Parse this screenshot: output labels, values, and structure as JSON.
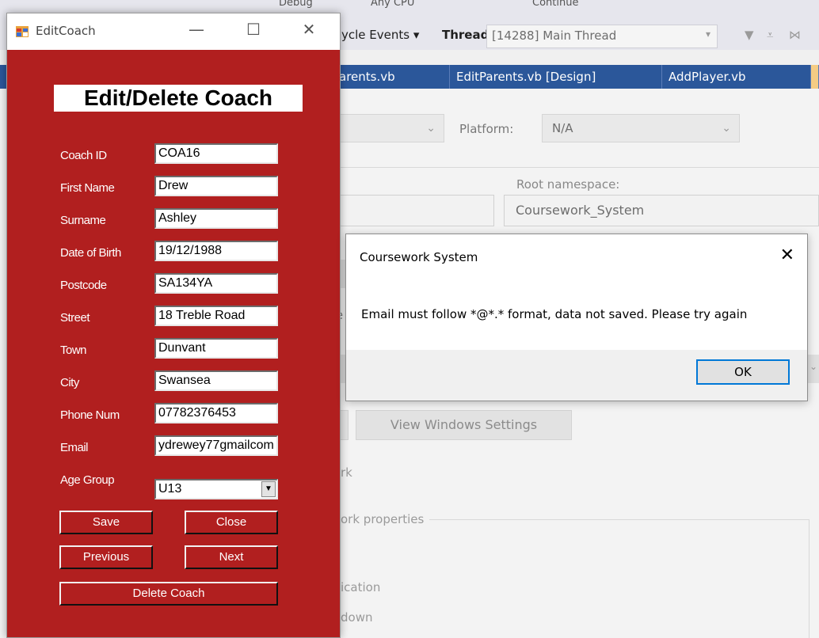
{
  "ide": {
    "toolbar_top": {
      "debug_label": "Debug",
      "cpu_label": "Any CPU",
      "continue_label": "Continue"
    },
    "toolbar": {
      "lifecycle_label": "ycle Events",
      "thread_label": "Thread:",
      "thread_value": "[14288] Main Thread"
    },
    "tabs": [
      {
        "label": "arents.vb"
      },
      {
        "label": "EditParents.vb [Design]"
      },
      {
        "label": "AddPlayer.vb"
      }
    ],
    "platform_label": "Platform:",
    "platform_value": "N/A",
    "root_namespace_label": "Root namespace:",
    "root_namespace_value": "Coursework_System",
    "view_windows_settings": "View Windows Settings",
    "partial_labels": [
      "re",
      "rk",
      "ork properties",
      "ication",
      "down"
    ]
  },
  "editcoach": {
    "window_title": "EditCoach",
    "heading": "Edit/Delete Coach",
    "fields": [
      {
        "label": "Coach ID",
        "value": "COA16"
      },
      {
        "label": "First Name",
        "value": "Drew"
      },
      {
        "label": "Surname",
        "value": "Ashley"
      },
      {
        "label": "Date of Birth",
        "value": "19/12/1988"
      },
      {
        "label": "Postcode",
        "value": "SA134YA"
      },
      {
        "label": "Street",
        "value": "18 Treble Road"
      },
      {
        "label": "Town",
        "value": "Dunvant"
      },
      {
        "label": "City",
        "value": "Swansea"
      },
      {
        "label": "Phone Num",
        "value": "07782376453"
      },
      {
        "label": "Email",
        "value": "ydrewey77gmailcom"
      }
    ],
    "age_group": {
      "label": "Age Group",
      "value": "U13"
    },
    "buttons": {
      "save": "Save",
      "close": "Close",
      "previous": "Previous",
      "next": "Next",
      "delete": "Delete Coach"
    },
    "colors": {
      "background": "#b11f1f"
    }
  },
  "dialog": {
    "title": "Coursework System",
    "message": "Email must follow *@*.* format, data not saved. Please try again",
    "ok_label": "OK"
  }
}
